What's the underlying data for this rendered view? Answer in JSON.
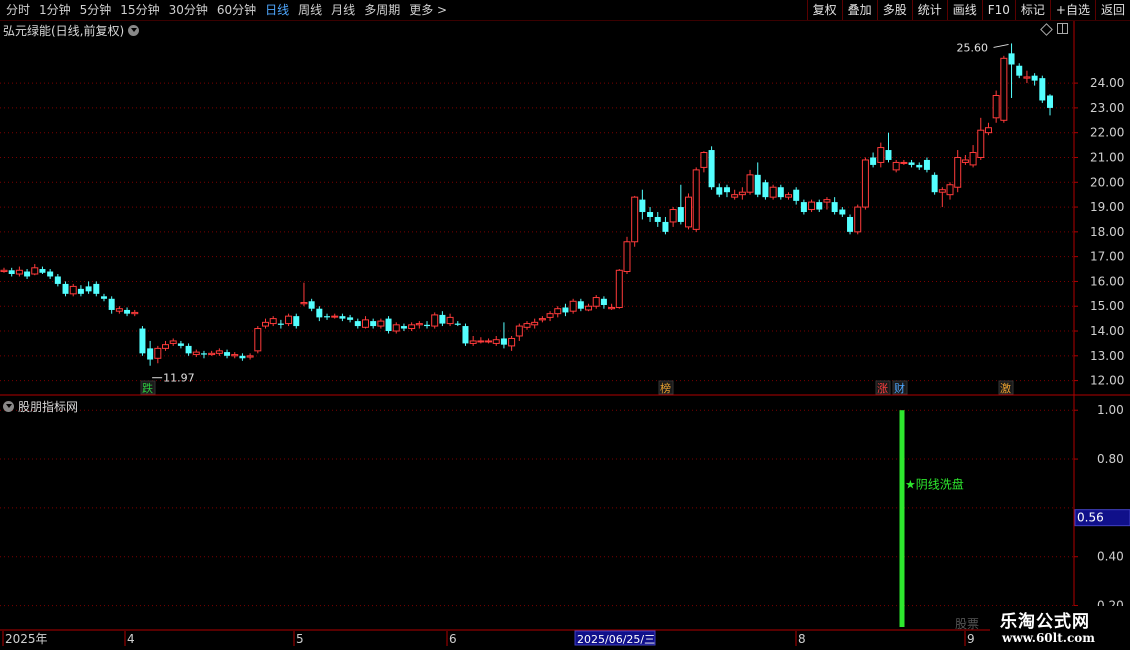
{
  "toolbar": {
    "periods": [
      "分时",
      "1分钟",
      "5分钟",
      "15分钟",
      "30分钟",
      "60分钟",
      "日线",
      "周线",
      "月线",
      "多周期",
      "更多 >"
    ],
    "active_period": "日线",
    "buttons": [
      "复权",
      "叠加",
      "多股",
      "统计",
      "画线",
      "F10",
      "标记",
      "+自选",
      "返回"
    ]
  },
  "stock": {
    "title": "弘元绿能(日线,前复权)"
  },
  "indicator": {
    "name": "股朋指标网",
    "signal_label": "阴线洗盘"
  },
  "price_axis": [
    "24.00",
    "23.00",
    "22.00",
    "21.00",
    "20.00",
    "19.00",
    "18.00",
    "17.00",
    "16.00",
    "15.00",
    "14.00",
    "13.00",
    "12.00"
  ],
  "indicator_axis": [
    "1.00",
    "0.80",
    "0.40",
    "0.20"
  ],
  "indicator_current": "0.56",
  "annotations": {
    "high": "25.60",
    "low": "11.97"
  },
  "markers": [
    {
      "text": "跌",
      "color": "#2ecc40"
    },
    {
      "text": "榜",
      "color": "#e8a030"
    },
    {
      "text": "涨",
      "color": "#ff4040"
    },
    {
      "text": "财",
      "color": "#4fa8ff"
    },
    {
      "text": "激",
      "color": "#e8a030"
    }
  ],
  "date_axis": [
    "2025年",
    "4",
    "5",
    "6",
    "8",
    "9"
  ],
  "cursor_date": "2025/06/25/三",
  "watermark": {
    "top": "乐淘公式网",
    "bottom": "www.60lt.com",
    "faint": "股票"
  },
  "colors": {
    "up": "#ff3b3b",
    "down": "#54ffff",
    "grid": "#7a0000",
    "signal": "#2ee82e",
    "accent": "#4fa8ff"
  },
  "chart_data": {
    "type": "candlestick",
    "price_range": [
      11.5,
      25.9
    ],
    "candles": [
      [
        16.4,
        16.45,
        16.55,
        16.35
      ],
      [
        16.45,
        16.3,
        16.55,
        16.2
      ],
      [
        16.3,
        16.45,
        16.6,
        16.2
      ],
      [
        16.4,
        16.2,
        16.5,
        16.1
      ],
      [
        16.3,
        16.55,
        16.7,
        16.25
      ],
      [
        16.5,
        16.35,
        16.6,
        16.3
      ],
      [
        16.4,
        16.2,
        16.5,
        16.1
      ],
      [
        16.2,
        15.9,
        16.3,
        15.8
      ],
      [
        15.9,
        15.5,
        16.0,
        15.4
      ],
      [
        15.5,
        15.8,
        15.9,
        15.4
      ],
      [
        15.7,
        15.5,
        15.85,
        15.4
      ],
      [
        15.8,
        15.6,
        16.0,
        15.5
      ],
      [
        15.9,
        15.5,
        16.0,
        15.4
      ],
      [
        15.4,
        15.3,
        15.5,
        15.2
      ],
      [
        15.3,
        14.85,
        15.4,
        14.7
      ],
      [
        14.8,
        14.9,
        15.0,
        14.7
      ],
      [
        14.85,
        14.7,
        14.95,
        14.6
      ],
      [
        14.7,
        14.75,
        14.85,
        14.6
      ],
      [
        14.1,
        13.1,
        14.2,
        13.0
      ],
      [
        13.3,
        12.85,
        13.6,
        12.6
      ],
      [
        12.9,
        13.3,
        13.4,
        12.7
      ],
      [
        13.3,
        13.45,
        13.6,
        13.2
      ],
      [
        13.5,
        13.6,
        13.7,
        13.4
      ],
      [
        13.5,
        13.4,
        13.6,
        13.3
      ],
      [
        13.4,
        13.1,
        13.5,
        13.0
      ],
      [
        13.05,
        13.15,
        13.25,
        12.95
      ],
      [
        13.1,
        13.05,
        13.2,
        12.9
      ],
      [
        13.05,
        13.1,
        13.2,
        13.0
      ],
      [
        13.1,
        13.2,
        13.3,
        13.0
      ],
      [
        13.15,
        13.0,
        13.25,
        12.9
      ],
      [
        13.0,
        13.05,
        13.15,
        12.9
      ],
      [
        13.0,
        12.9,
        13.1,
        12.8
      ],
      [
        12.95,
        13.0,
        13.1,
        12.85
      ],
      [
        13.2,
        14.1,
        14.2,
        13.1
      ],
      [
        14.2,
        14.35,
        14.5,
        14.1
      ],
      [
        14.3,
        14.5,
        14.6,
        14.2
      ],
      [
        14.3,
        14.25,
        14.45,
        14.1
      ],
      [
        14.3,
        14.6,
        14.7,
        14.2
      ],
      [
        14.6,
        14.2,
        14.7,
        14.1
      ],
      [
        15.1,
        15.15,
        15.95,
        15.0
      ],
      [
        15.2,
        14.9,
        15.3,
        14.8
      ],
      [
        14.9,
        14.55,
        15.0,
        14.4
      ],
      [
        14.6,
        14.55,
        14.7,
        14.45
      ],
      [
        14.6,
        14.6,
        14.7,
        14.5
      ],
      [
        14.6,
        14.5,
        14.7,
        14.4
      ],
      [
        14.55,
        14.45,
        14.65,
        14.35
      ],
      [
        14.4,
        14.2,
        14.5,
        14.1
      ],
      [
        14.15,
        14.45,
        14.6,
        14.1
      ],
      [
        14.4,
        14.2,
        14.5,
        14.1
      ],
      [
        14.2,
        14.4,
        14.5,
        14.1
      ],
      [
        14.5,
        14.0,
        14.6,
        13.9
      ],
      [
        14.0,
        14.25,
        14.35,
        13.9
      ],
      [
        14.2,
        14.1,
        14.3,
        14.0
      ],
      [
        14.1,
        14.25,
        14.35,
        14.0
      ],
      [
        14.25,
        14.3,
        14.4,
        14.1
      ],
      [
        14.25,
        14.2,
        14.4,
        14.1
      ],
      [
        14.2,
        14.65,
        14.75,
        14.1
      ],
      [
        14.65,
        14.3,
        14.8,
        14.2
      ],
      [
        14.3,
        14.55,
        14.7,
        14.2
      ],
      [
        14.3,
        14.25,
        14.4,
        14.2
      ],
      [
        14.2,
        13.5,
        14.3,
        13.4
      ],
      [
        13.5,
        13.6,
        13.8,
        13.4
      ],
      [
        13.6,
        13.6,
        13.75,
        13.5
      ],
      [
        13.6,
        13.6,
        13.7,
        13.5
      ],
      [
        13.5,
        13.65,
        13.8,
        13.4
      ],
      [
        13.7,
        13.45,
        14.35,
        13.3
      ],
      [
        13.4,
        13.7,
        13.8,
        13.2
      ],
      [
        13.8,
        14.2,
        14.3,
        13.6
      ],
      [
        14.15,
        14.3,
        14.4,
        14.05
      ],
      [
        14.25,
        14.35,
        14.5,
        14.1
      ],
      [
        14.45,
        14.5,
        14.6,
        14.35
      ],
      [
        14.55,
        14.7,
        14.8,
        14.4
      ],
      [
        14.7,
        14.9,
        15.0,
        14.55
      ],
      [
        14.95,
        14.75,
        15.1,
        14.6
      ],
      [
        14.8,
        15.2,
        15.3,
        14.7
      ],
      [
        15.2,
        14.9,
        15.3,
        14.8
      ],
      [
        14.85,
        15.0,
        15.1,
        14.8
      ],
      [
        15.0,
        15.35,
        15.45,
        14.9
      ],
      [
        15.3,
        15.05,
        15.4,
        14.9
      ],
      [
        14.9,
        14.95,
        15.1,
        14.85
      ],
      [
        14.95,
        16.45,
        16.5,
        14.9
      ],
      [
        16.4,
        17.6,
        17.8,
        16.3
      ],
      [
        17.6,
        19.4,
        19.45,
        17.4
      ],
      [
        19.3,
        18.8,
        19.7,
        18.5
      ],
      [
        18.8,
        18.6,
        19.0,
        18.4
      ],
      [
        18.6,
        18.4,
        18.8,
        18.2
      ],
      [
        18.4,
        18.0,
        18.6,
        17.9
      ],
      [
        18.4,
        18.9,
        19.0,
        18.2
      ],
      [
        19.0,
        18.4,
        19.9,
        18.3
      ],
      [
        18.2,
        19.4,
        19.55,
        18.1
      ],
      [
        18.1,
        20.5,
        20.6,
        18.0
      ],
      [
        20.6,
        21.2,
        21.25,
        20.4
      ],
      [
        21.3,
        19.8,
        21.45,
        19.7
      ],
      [
        19.8,
        19.5,
        19.95,
        19.4
      ],
      [
        19.8,
        19.6,
        19.9,
        19.4
      ],
      [
        19.4,
        19.5,
        19.7,
        19.3
      ],
      [
        19.5,
        19.6,
        19.8,
        19.3
      ],
      [
        19.6,
        20.3,
        20.5,
        19.5
      ],
      [
        20.3,
        19.5,
        20.8,
        19.4
      ],
      [
        20.0,
        19.4,
        20.1,
        19.3
      ],
      [
        19.4,
        19.8,
        19.9,
        19.3
      ],
      [
        19.8,
        19.4,
        19.9,
        19.3
      ],
      [
        19.4,
        19.5,
        19.6,
        19.3
      ],
      [
        19.7,
        19.25,
        19.8,
        19.1
      ],
      [
        19.2,
        18.8,
        19.3,
        18.7
      ],
      [
        18.9,
        19.2,
        19.3,
        18.8
      ],
      [
        19.2,
        18.9,
        19.3,
        18.8
      ],
      [
        19.2,
        19.3,
        19.4,
        18.9
      ],
      [
        19.2,
        18.8,
        19.4,
        18.7
      ],
      [
        18.9,
        18.7,
        19.0,
        18.6
      ],
      [
        18.6,
        18.0,
        18.7,
        17.9
      ],
      [
        18.0,
        19.0,
        19.1,
        17.9
      ],
      [
        19.0,
        20.9,
        21.0,
        18.9
      ],
      [
        21.0,
        20.7,
        21.2,
        20.6
      ],
      [
        20.8,
        21.4,
        21.6,
        20.6
      ],
      [
        21.3,
        20.9,
        22.0,
        20.8
      ],
      [
        20.5,
        20.8,
        20.9,
        20.4
      ],
      [
        20.8,
        20.8,
        20.9,
        20.7
      ],
      [
        20.8,
        20.7,
        20.9,
        20.6
      ],
      [
        20.7,
        20.6,
        20.8,
        20.5
      ],
      [
        20.9,
        20.5,
        21.0,
        20.4
      ],
      [
        20.3,
        19.6,
        20.4,
        19.5
      ],
      [
        19.6,
        19.7,
        19.8,
        19.0
      ],
      [
        19.5,
        19.9,
        20.0,
        19.3
      ],
      [
        19.8,
        21.0,
        21.3,
        19.6
      ],
      [
        20.8,
        20.9,
        21.1,
        20.7
      ],
      [
        20.7,
        21.2,
        21.5,
        20.6
      ],
      [
        21.0,
        22.1,
        22.6,
        20.9
      ],
      [
        22.0,
        22.2,
        22.4,
        21.9
      ],
      [
        22.6,
        23.5,
        23.7,
        22.4
      ],
      [
        22.5,
        25.0,
        25.1,
        22.4
      ],
      [
        25.2,
        24.75,
        25.6,
        23.4
      ],
      [
        24.7,
        24.3,
        24.8,
        24.2
      ],
      [
        24.2,
        24.25,
        24.5,
        24.0
      ],
      [
        24.3,
        24.1,
        24.4,
        23.9
      ],
      [
        24.2,
        23.3,
        24.3,
        23.2
      ],
      [
        23.5,
        23.0,
        23.55,
        22.7
      ]
    ],
    "indicator_signal": {
      "value": 1.0,
      "label": "阴线洗盘"
    },
    "indicator_range": [
      0.1,
      1.05
    ]
  }
}
